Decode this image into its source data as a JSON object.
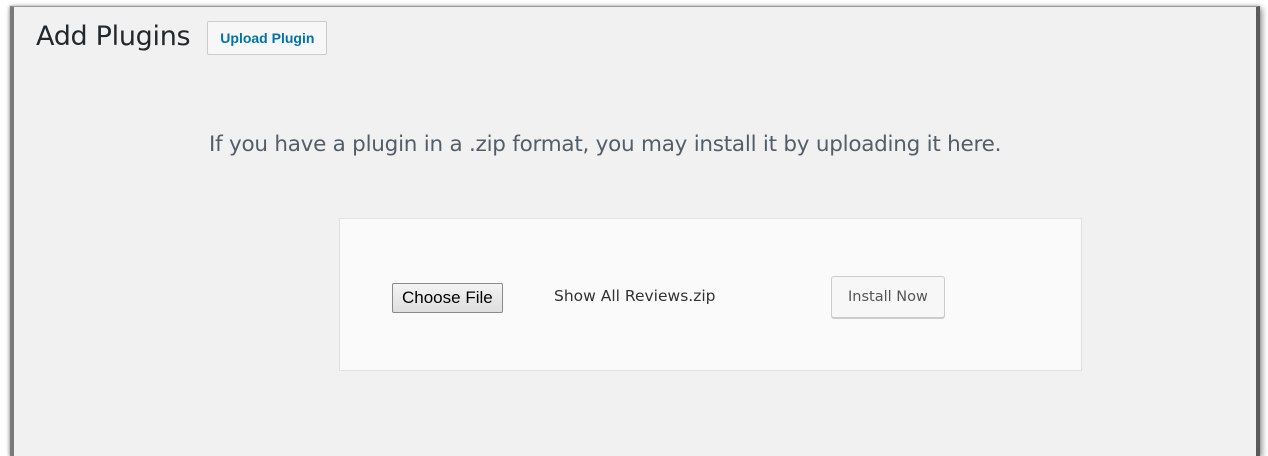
{
  "header": {
    "title": "Add Plugins",
    "upload_button_label": "Upload Plugin"
  },
  "upload": {
    "help_text": "If you have a plugin in a .zip format, you may install it by uploading it here.",
    "choose_file_label": "Choose File",
    "selected_file": "Show All Reviews.zip",
    "install_button_label": "Install Now"
  },
  "colors": {
    "background": "#f1f1f1",
    "link_blue": "#0073aa",
    "title_text": "#23282d",
    "help_text": "#555d66"
  }
}
